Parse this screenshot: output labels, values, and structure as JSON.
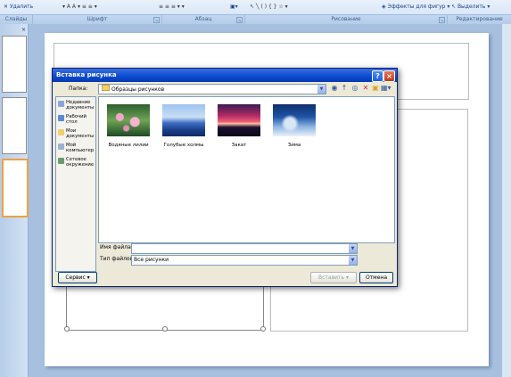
{
  "ribbon": {
    "delete_label": "Удалить",
    "effects_label": "Эффекты для фигур",
    "select_label": "Выделить",
    "groups": [
      "Слайды",
      "Шрифт",
      "Абзац",
      "Рисование",
      "Редактирование"
    ]
  },
  "dialog": {
    "title": "Вставка рисунка",
    "folder_label": "Папка:",
    "folder_value": "Образцы рисунков",
    "places": [
      "Недавние документы",
      "Рабочий стол",
      "Мои документы",
      "Мой компьютер",
      "Сетевое окружение"
    ],
    "files": [
      {
        "name": "Водяные лилии",
        "icon": "water-lilies-thumbnail"
      },
      {
        "name": "Голубые холмы",
        "icon": "blue-hills-thumbnail"
      },
      {
        "name": "Закат",
        "icon": "sunset-thumbnail"
      },
      {
        "name": "Зима",
        "icon": "winter-thumbnail"
      }
    ],
    "filename_label": "Имя файла:",
    "filename_value": "",
    "filetype_label": "Тип файлов:",
    "filetype_value": "Все рисунки",
    "service_label": "Сервис",
    "insert_label": "Вставить",
    "cancel_label": "Отмена"
  },
  "colors": {
    "titlebar": "#0a4ad0",
    "dialog_bg": "#ece9d8",
    "slide_bg": "#ffffff"
  }
}
